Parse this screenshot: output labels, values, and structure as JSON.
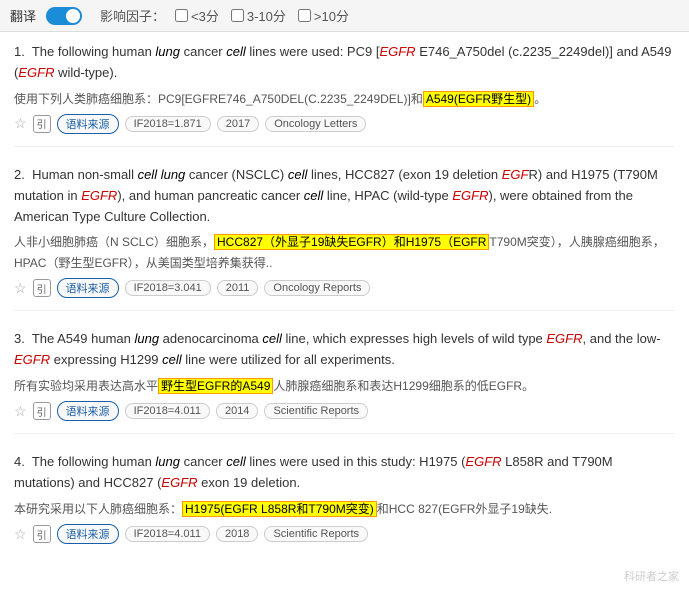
{
  "topbar": {
    "translate_label": "翻译",
    "toggle_state": "on",
    "filter_label": "影响因子：",
    "filters": [
      {
        "label": "<3分",
        "checked": false
      },
      {
        "label": "3-10分",
        "checked": false
      },
      {
        "label": ">10分",
        "checked": false
      }
    ]
  },
  "results": [
    {
      "number": "1.",
      "en_text_parts": [
        {
          "text": "The following human ",
          "type": "normal"
        },
        {
          "text": "lung",
          "type": "italic"
        },
        {
          "text": " cancer ",
          "type": "normal"
        },
        {
          "text": "cell",
          "type": "italic"
        },
        {
          "text": " lines were used: PC9 [",
          "type": "normal"
        },
        {
          "text": "EGFR",
          "type": "egfr"
        },
        {
          "text": " E746_A750del (c.2235_2249del)] and A549 (",
          "type": "normal"
        },
        {
          "text": "EGFR",
          "type": "egfr"
        },
        {
          "text": " wild-type).",
          "type": "normal"
        }
      ],
      "cn_text": "使用下列人类肺癌细胞系：PC9[EGFRE746_A750DEL(C.2235_2249DEL)]和",
      "cn_highlight": "A549(EGFR野生型)。",
      "cn_highlight_type": "yellow",
      "meta": {
        "star": "☆",
        "cite": "引",
        "source_label": "语料来源",
        "if_label": "IF2018=1.871",
        "year": "2017",
        "journal": "Oncology Letters"
      }
    },
    {
      "number": "2.",
      "en_text_parts": [
        {
          "text": "Human non-small ",
          "type": "normal"
        },
        {
          "text": "cell lung",
          "type": "italic"
        },
        {
          "text": " cancer (NSCLC) ",
          "type": "normal"
        },
        {
          "text": "cell",
          "type": "italic"
        },
        {
          "text": " lines, HCC827 (exon 19 deletion ",
          "type": "normal"
        },
        {
          "text": "EGF",
          "type": "egfr"
        },
        {
          "text": " R) and H1975 (T790M mutation in ",
          "type": "normal"
        },
        {
          "text": "EGFR",
          "type": "egfr"
        },
        {
          "text": "), and human pancreatic cancer ",
          "type": "normal"
        },
        {
          "text": "cell",
          "type": "italic"
        },
        {
          "text": " line, HPAC (wild-type ",
          "type": "normal"
        },
        {
          "text": "EGFR",
          "type": "egfr"
        },
        {
          "text": "), were obtained from the American Type Culture Collection.",
          "type": "normal"
        }
      ],
      "cn_text": "人非小细胞肺癌（N SCLC）细胞系，",
      "cn_highlight": "HCC827（外显子19缺失EGFR）和H1975（EGFR",
      "cn_highlight_type": "yellow",
      "cn_text2": "T790M突变），人胰腺癌细胞系，HPAC（野生型EGFR），从美国类型培养集获得..",
      "meta": {
        "star": "☆",
        "cite": "引",
        "source_label": "语料来源",
        "if_label": "IF2018=3.041",
        "year": "2011",
        "journal": "Oncology Reports"
      }
    },
    {
      "number": "3.",
      "en_text_parts": [
        {
          "text": "The A549 human ",
          "type": "normal"
        },
        {
          "text": "lung",
          "type": "italic"
        },
        {
          "text": " adenocarcinoma ",
          "type": "normal"
        },
        {
          "text": "cell",
          "type": "italic"
        },
        {
          "text": " line, which expresses high levels of wild type ",
          "type": "normal"
        },
        {
          "text": "EGFR",
          "type": "egfr"
        },
        {
          "text": ", and the low-",
          "type": "normal"
        },
        {
          "text": "EGFR",
          "type": "egfr"
        },
        {
          "text": " expressing H1299 ",
          "type": "normal"
        },
        {
          "text": "cell",
          "type": "italic"
        },
        {
          "text": " line were utilized for all experiments.",
          "type": "normal"
        }
      ],
      "cn_text": "所有实验均采用表达高水平",
      "cn_highlight": "野生型EGFR的A549",
      "cn_highlight_type": "yellow",
      "cn_text2": "人肺腺癌细胞系和表达H1299细胞系的低EGFR。",
      "meta": {
        "star": "☆",
        "cite": "引",
        "source_label": "语料来源",
        "if_label": "IF2018=4.011",
        "year": "2014",
        "journal": "Scientific Reports"
      }
    },
    {
      "number": "4.",
      "en_text_parts": [
        {
          "text": "The following human ",
          "type": "normal"
        },
        {
          "text": "lung",
          "type": "italic"
        },
        {
          "text": " cancer ",
          "type": "normal"
        },
        {
          "text": "cell",
          "type": "italic"
        },
        {
          "text": " lines were used in this study: H1975 (",
          "type": "normal"
        },
        {
          "text": "EGFR",
          "type": "egfr"
        },
        {
          "text": " L858R and T790M mutations) and HCC827 (",
          "type": "normal"
        },
        {
          "text": "EGFR",
          "type": "egfr"
        },
        {
          "text": " exon 19 deletion.",
          "type": "normal"
        }
      ],
      "cn_text": "本研究采用以下人肺癌细胞系：",
      "cn_highlight": "H1975(EGFR L858R和T790M突变)",
      "cn_highlight_type": "yellow",
      "cn_text2": "和HCC 827(EGFR外显子19缺失.",
      "meta": {
        "star": "☆",
        "cite": "引",
        "source_label": "语料来源",
        "if_label": "IF2018=4.011",
        "year": "2018",
        "journal": "Scientific Reports"
      }
    }
  ],
  "watermark": "科研者之家"
}
